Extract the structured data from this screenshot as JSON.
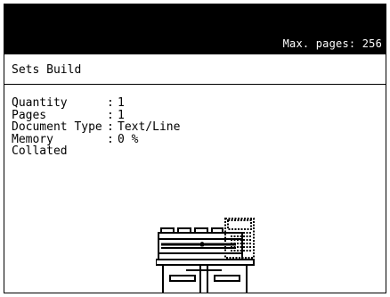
{
  "header": {
    "max_pages_label": "Max. pages: 256"
  },
  "screen": {
    "title": "Sets Build"
  },
  "info": {
    "rows": [
      {
        "label": "Quantity",
        "sep": ":",
        "value": "1"
      },
      {
        "label": "Pages",
        "sep": ":",
        "value": "1"
      },
      {
        "label": "Document Type",
        "sep": ":",
        "value": "Text/Line"
      },
      {
        "label": "Memory",
        "sep": ":",
        "value": "0 %"
      },
      {
        "label": "Collated",
        "sep": "",
        "value": ""
      }
    ]
  },
  "icons": {
    "illustration": "printer-scanner-icon"
  }
}
